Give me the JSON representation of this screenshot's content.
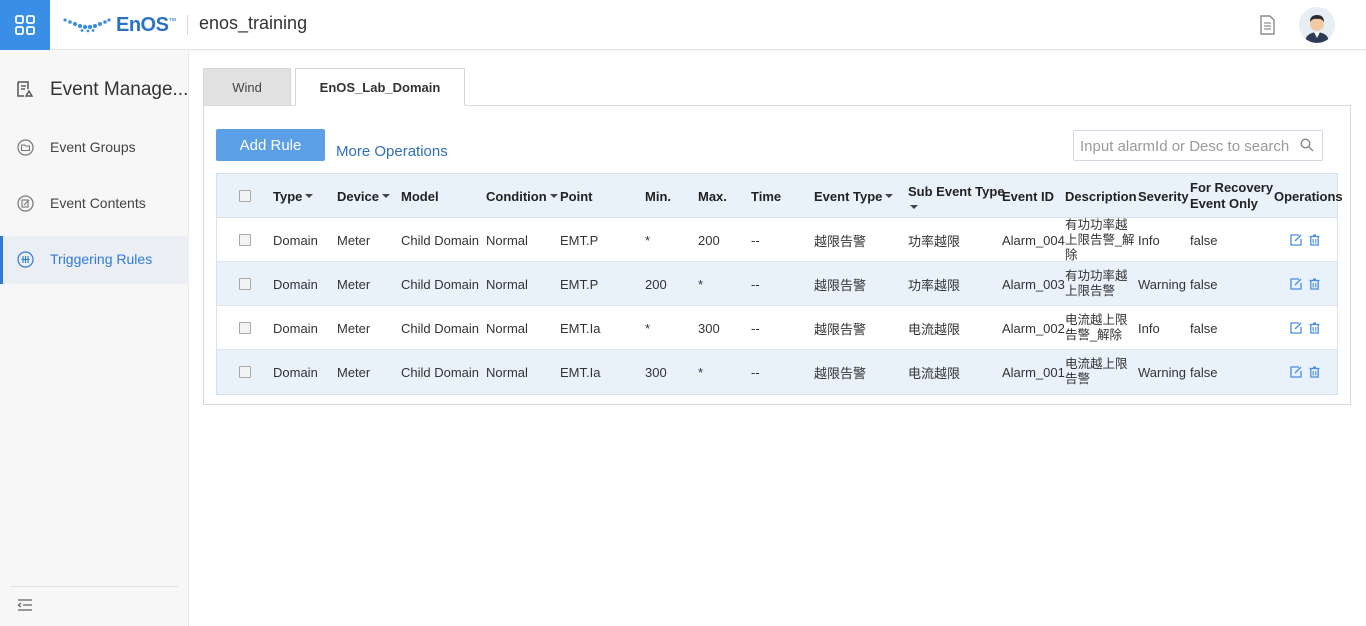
{
  "header": {
    "logo_text": "EnOS",
    "logo_tm": "™",
    "org_name": "enos_training",
    "accent": "#3a8ee6"
  },
  "sidebar": {
    "title": "Event Manage...",
    "items": [
      {
        "label": "Event Groups",
        "icon": "folder-icon",
        "active": false
      },
      {
        "label": "Event Contents",
        "icon": "edit-doc-icon",
        "active": false
      },
      {
        "label": "Triggering Rules",
        "icon": "rules-icon",
        "active": true
      }
    ]
  },
  "tabs": [
    {
      "label": "Wind",
      "active": false
    },
    {
      "label": "EnOS_Lab_Domain",
      "active": true
    }
  ],
  "toolbar": {
    "add_rule_label": "Add Rule",
    "more_ops_label": "More Operations",
    "search_placeholder": "Input alarmId or Desc to search"
  },
  "table": {
    "headers": {
      "type": "Type",
      "device": "Device",
      "model": "Model",
      "condition": "Condition",
      "point": "Point",
      "min": "Min.",
      "max": "Max.",
      "time": "Time",
      "event_type": "Event Type",
      "sub_event_type": "Sub Event Type",
      "event_id": "Event ID",
      "description": "Description",
      "severity": "Severity",
      "recovery_1": "For Recovery",
      "recovery_2": "Event Only",
      "operations": "Operations"
    },
    "rows": [
      {
        "type": "Domain",
        "device": "Meter",
        "model": "Child Domain",
        "condition": "Normal",
        "point": "EMT.P",
        "min": "*",
        "max": "200",
        "time": "--",
        "event_type": "越限告警",
        "sub_event_type": "功率越限",
        "event_id": "Alarm_004",
        "description": "有功功率越上限告警_解除",
        "severity": "Info",
        "recovery": "false"
      },
      {
        "type": "Domain",
        "device": "Meter",
        "model": "Child Domain",
        "condition": "Normal",
        "point": "EMT.P",
        "min": "200",
        "max": "*",
        "time": "--",
        "event_type": "越限告警",
        "sub_event_type": "功率越限",
        "event_id": "Alarm_003",
        "description": "有功功率越上限告警",
        "severity": "Warning",
        "recovery": "false"
      },
      {
        "type": "Domain",
        "device": "Meter",
        "model": "Child Domain",
        "condition": "Normal",
        "point": "EMT.Ia",
        "min": "*",
        "max": "300",
        "time": "--",
        "event_type": "越限告警",
        "sub_event_type": "电流越限",
        "event_id": "Alarm_002",
        "description": "电流越上限告警_解除",
        "severity": "Info",
        "recovery": "false"
      },
      {
        "type": "Domain",
        "device": "Meter",
        "model": "Child Domain",
        "condition": "Normal",
        "point": "EMT.Ia",
        "min": "300",
        "max": "*",
        "time": "--",
        "event_type": "越限告警",
        "sub_event_type": "电流越限",
        "event_id": "Alarm_001",
        "description": "电流越上限告警",
        "severity": "Warning",
        "recovery": "false"
      }
    ]
  }
}
